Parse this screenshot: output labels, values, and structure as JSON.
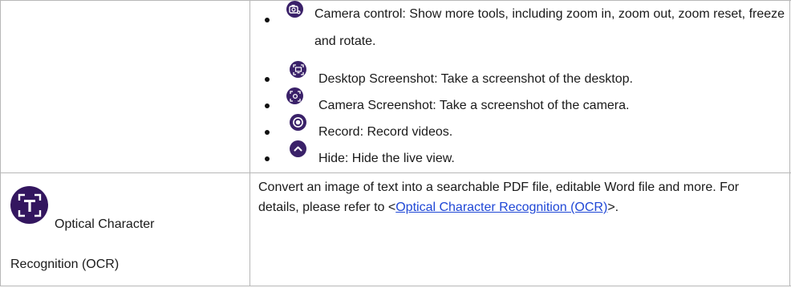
{
  "bullets": [
    {
      "icon": "camera-control-icon",
      "text": "Camera control: Show more tools, including zoom in, zoom out, zoom reset, freeze and rotate."
    },
    {
      "icon": "desktop-screenshot-icon",
      "text": "Desktop Screenshot: Take a screenshot of the desktop."
    },
    {
      "icon": "camera-screenshot-icon",
      "text": "Camera Screenshot: Take a screenshot of the camera."
    },
    {
      "icon": "record-icon",
      "text": "Record: Record videos."
    },
    {
      "icon": "hide-icon",
      "text": "Hide: Hide the live view."
    }
  ],
  "ocr_feature": {
    "icon": "ocr-icon",
    "label_line1": "Optical Character",
    "label_line2": "Recognition (OCR)",
    "description_prefix": "Convert an image of text into a searchable PDF file, editable Word file and more. For details, please refer to <",
    "link_text": "Optical Character Recognition (OCR)",
    "description_suffix": ">."
  },
  "colors": {
    "icon_purple": "#3a2169",
    "link_blue": "#1f47d6",
    "grid_gray": "#b7b7b7"
  }
}
